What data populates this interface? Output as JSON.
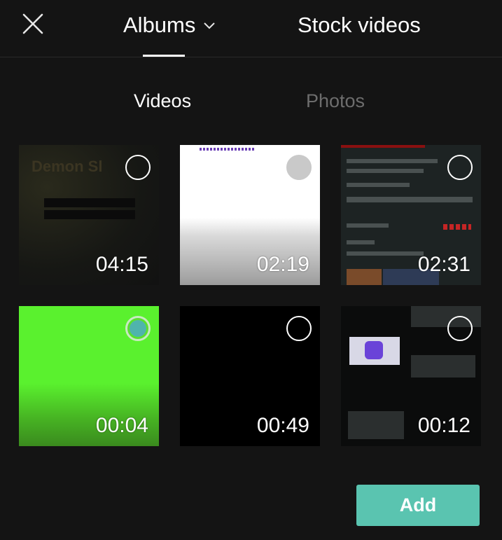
{
  "header": {
    "albums_label": "Albums",
    "stock_label": "Stock videos"
  },
  "subtabs": {
    "videos_label": "Videos",
    "photos_label": "Photos"
  },
  "media": [
    {
      "duration": "04:15",
      "selected": false
    },
    {
      "duration": "02:19",
      "selected": false
    },
    {
      "duration": "02:31",
      "selected": false
    },
    {
      "duration": "00:04",
      "selected": true
    },
    {
      "duration": "00:49",
      "selected": false
    },
    {
      "duration": "00:12",
      "selected": false
    }
  ],
  "actions": {
    "add_label": "Add"
  },
  "colors": {
    "background": "#141414",
    "accent": "#5ac4b0",
    "inactive_tab": "#6d6d6d"
  },
  "icons": {
    "close": "close-icon",
    "dropdown": "chevron-down-icon"
  }
}
